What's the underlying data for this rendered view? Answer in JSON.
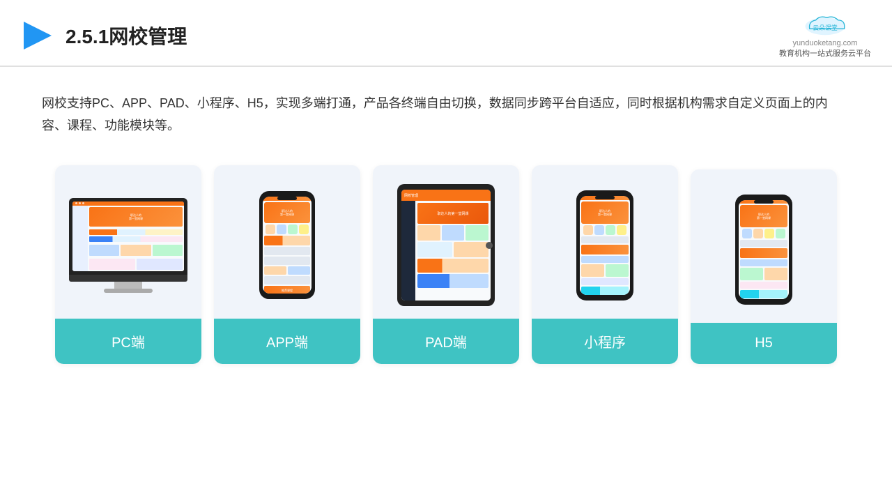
{
  "header": {
    "title": "2.5.1网校管理",
    "logo_url": "yunduoketang.com",
    "logo_tagline": "教育机构一站式服务云平台"
  },
  "description": "网校支持PC、APP、PAD、小程序、H5，实现多端打通，产品各终端自由切换，数据同步跨平台自适应，同时根据机构需求自定义页面上的内容、课程、功能模块等。",
  "cards": [
    {
      "id": "pc",
      "label": "PC端"
    },
    {
      "id": "app",
      "label": "APP端"
    },
    {
      "id": "pad",
      "label": "PAD端"
    },
    {
      "id": "miniprogram",
      "label": "小程序"
    },
    {
      "id": "h5",
      "label": "H5"
    }
  ],
  "accent_color": "#3fc3c3"
}
